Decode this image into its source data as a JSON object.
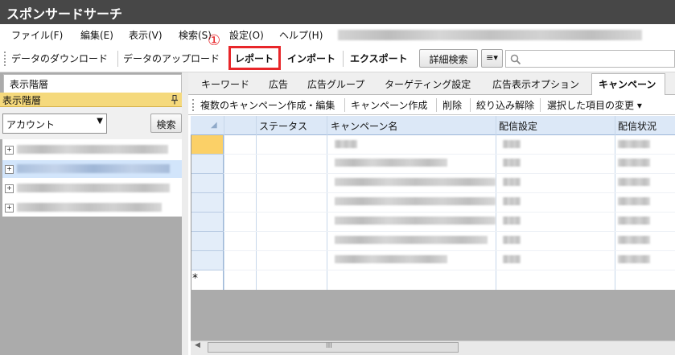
{
  "title": "スポンサードサーチ",
  "menu": [
    "ファイル(F)",
    "編集(E)",
    "表示(V)",
    "検索(S)",
    "設定(O)",
    "ヘルプ(H)"
  ],
  "toolbar": {
    "download": "データのダウンロード",
    "upload": "データのアップロード",
    "report": "レポート",
    "import": "インポート",
    "export": "エクスポート",
    "advanced_search": "詳細検索",
    "menu_glyph": "≡▾",
    "callout": "①"
  },
  "left_panel": {
    "tab": "表示階層",
    "header": "表示階層",
    "pin_glyph": "ᵖ",
    "account_select": "アカウント",
    "search_button": "検索",
    "tree_expander": "+"
  },
  "tabs": [
    "キーワード",
    "広告",
    "広告グループ",
    "ターゲティング設定",
    "広告表示オプション",
    "キャンペーン"
  ],
  "sub_toolbar": [
    "複数のキャンペーン作成・編集",
    "キャンペーン作成",
    "削除",
    "絞り込み解除",
    "選択した項目の変更 ▾"
  ],
  "grid": {
    "columns": [
      "ステータス",
      "キャンペーン名",
      "配信設定",
      "配信状況"
    ],
    "new_row_marker": "*",
    "corner_glyph": "◢"
  },
  "scrollbar_grip": "III",
  "icons": {
    "search": "search-icon",
    "pin": "pin-icon",
    "dropdown": "chevron-down-icon"
  },
  "colors": {
    "titlebar": "#474747",
    "highlight": "#e8262a",
    "current_row": "#fbd067",
    "left_header": "#f5d97c"
  }
}
